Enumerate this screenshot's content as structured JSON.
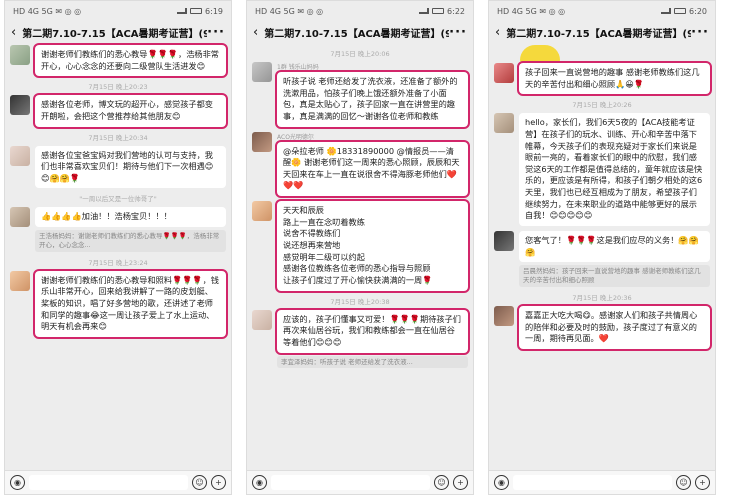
{
  "title": "第二期7.10-7.15【ACA暑期考证营】(93)",
  "screens": [
    {
      "status": {
        "left": "HD 4G 5G ✉ ◎ ◎",
        "time": "6:19"
      },
      "messages": [
        {
          "sender": "",
          "text": "谢谢老师们教练们的悉心教导🌹🌹🌹，浩杨非常开心，心心念念的还要向二级营队生活进发😊",
          "hl": true
        },
        {
          "time": "7月15日 晚上20:23"
        },
        {
          "sender": "",
          "text": "感谢各位老师，博文玩的超开心，感觉孩子都变开朗啦，会把这个营推荐给其他朋友😊",
          "hl": true
        },
        {
          "time": "7月15日 晚上20:34"
        },
        {
          "sender": "",
          "text": "感谢各位宝爸宝妈对我们营地的认可与支持，我们也非常喜欢宝贝们！期待与他们下一次相遇😊😊🤗🤗🌹",
          "hl": false
        },
        {
          "time": "\"一周以后又是一位帅哥了\""
        },
        {
          "sender": "",
          "text": "👍👍👍👍加油！！浩杨宝贝！！！",
          "hl": false,
          "quote": "王浩杨妈妈：谢谢老师们教练们的悉心教导🌹🌹🌹，浩杨非常开心，心心念念..."
        },
        {
          "time": "7月15日 晚上23:24"
        },
        {
          "sender": "",
          "text": "谢谢老师们教练们的悉心教导和照料🌹🌹🌹，钱乐山非常开心，回来给我讲解了一路的皮划艇、桨板的知识，唱了好多营地的歌，还讲述了老师和同学的趣事😂这一周让孩子爱上了水上运动、明天有机会再来😊",
          "hl": true
        }
      ]
    },
    {
      "status": {
        "left": "HD 4G 5G ✉ ◎ ◎",
        "time": "6:22"
      },
      "messages": [
        {
          "time": "7月15日 晚上20:06"
        },
        {
          "sender": "1群 钱乐山妈妈",
          "text": "听孩子说 老师还给发了洗衣液，还准备了额外的洗漱用品，怕孩子们晚上饿还额外准备了小面包，真是太贴心了，孩子回家一直在讲营里的趣事，真是满满的回忆～谢谢各位老师和教练",
          "hl": true
        },
        {
          "sender": "ACO光明德尔",
          "text": "@朵拉老师 🌼18331890000 @情报员——清醒🌼 谢谢老师们这一周来的悉心照顾，辰辰和天天回来在车上一直在说很舍不得海豚老师他们❤️❤️❤️",
          "hl": true
        },
        {
          "sender": "",
          "text": "天天和辰辰\n路上一直在念叨着教练\n说舍不得教练们\n说还想再来营地\n感觉明年二级可以约起\n感谢各位教练各位老师的悉心指导与照顾\n让孩子们度过了开心愉快获满满的一周🌹",
          "hl": true
        },
        {
          "time": "7月15日 晚上20:38"
        },
        {
          "sender": "",
          "text": "应该的，孩子们懂事又可爱！🌹🌹🌹期待孩子们再次来仙居谷玩，我们和教练都会一直在仙居谷等着他们😊😊😊",
          "hl": true,
          "quote": "李宜泽妈妈：听孩子说 老师还给发了洗衣液..."
        }
      ]
    },
    {
      "status": {
        "left": "HD 4G 5G ✉ ◎ ◎",
        "time": "6:20"
      },
      "messages": [
        {
          "sticker": true
        },
        {
          "sender": "",
          "text": "孩子回来一直说营地的趣事 感谢老师教练们这几天的辛苦付出和细心照顾🙏😀🌹",
          "hl": true
        },
        {
          "time": "7月15日 晚上20:26"
        },
        {
          "sender": "",
          "text": "hello，家长们，我们6天5夜的【ACA技能考证营】在孩子们的玩水、训练、开心和辛苦中落下帷幕，今天孩子们的表现充疑对于家长们来说是眼前一亮的，看着家长们的眼中的欣慰，我们感觉这6天的工作都是值得总结的，童年就应该是快乐的，更应该是有所得，和孩子们朝夕相处的这6天里，我们也已经互相成为了朋友，希望孩子们继续努力，在未来职业的道路中能够更好的展示自我！😊😊😊😊😊",
          "hl": false
        },
        {
          "sender": "",
          "text": "您客气了！🌹🌹🌹这是我们应尽的义务！🤗🤗🤗",
          "hl": false,
          "quote": "吕晨然妈妈：孩子回来一直说营地的趣事 感谢老师教练们这几天的辛苦付出和细心照顾"
        },
        {
          "time": "7月15日 晚上20:36"
        },
        {
          "sender": "",
          "text": "嘉嘉正大吃大喝😋。感谢家人们和孩子共情周心的陪伴和必要及时的鼓励，孩子度过了有意义的一周，期待再见面。❤️",
          "hl": true
        }
      ]
    }
  ]
}
